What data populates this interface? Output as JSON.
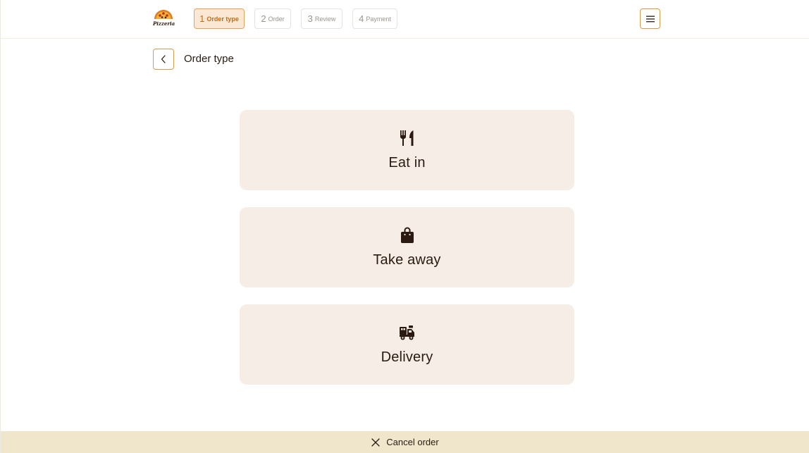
{
  "brand": {
    "logo_text": "Pizzeria"
  },
  "steps": [
    {
      "num": "1",
      "label": "Order type",
      "active": true
    },
    {
      "num": "2",
      "label": "Order",
      "active": false
    },
    {
      "num": "3",
      "label": "Review",
      "active": false
    },
    {
      "num": "4",
      "label": "Payment",
      "active": false
    }
  ],
  "header": {
    "menu_icon": "hamburger-menu-icon"
  },
  "page": {
    "title": "Order type",
    "back_icon": "chevron-left-icon"
  },
  "options": [
    {
      "label": "Eat in",
      "icon": "utensils-icon"
    },
    {
      "label": "Take away",
      "icon": "shopping-bag-icon"
    },
    {
      "label": "Delivery",
      "icon": "delivery-truck-icon"
    }
  ],
  "footer": {
    "cancel_label": "Cancel order",
    "cancel_icon": "close-icon"
  },
  "colors": {
    "accent": "#d99a4a",
    "active_step_bg": "#fbe8d4",
    "active_step_text": "#c46a12",
    "option_bg": "#f6eee6",
    "footer_bg": "#efe6cc",
    "text": "#2a1a12"
  }
}
